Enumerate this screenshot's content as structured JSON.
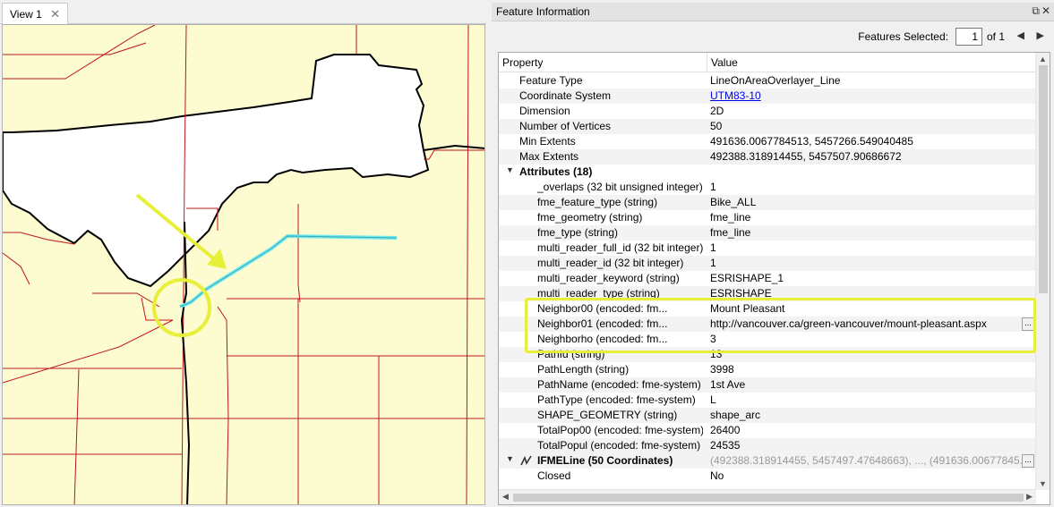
{
  "view": {
    "tab_label": "View 1",
    "tab_close": "✕"
  },
  "info": {
    "title": "Feature Information",
    "float_icon": "⧉",
    "close_icon": "✕",
    "features_selected_label": "Features Selected:",
    "selected_value": "1",
    "of_total": "of 1",
    "prev_icon": "◀",
    "next_icon": "▶"
  },
  "table": {
    "header_property": "Property",
    "header_value": "Value",
    "rows": [
      {
        "k": "Feature Type",
        "v": "LineOnAreaOverlayer_Line"
      },
      {
        "k": "Coordinate System",
        "v": "UTM83-10",
        "link": true
      },
      {
        "k": "Dimension",
        "v": "2D"
      },
      {
        "k": "Number of Vertices",
        "v": "50"
      },
      {
        "k": "Min Extents",
        "v": "491636.0067784513, 5457266.549040485"
      },
      {
        "k": "Max Extents",
        "v": "492388.318914455, 5457507.90686672"
      }
    ],
    "attributes_section": "Attributes (18)",
    "attributes": [
      {
        "k": "_overlaps (32 bit unsigned integer)",
        "v": "1"
      },
      {
        "k": "fme_feature_type (string)",
        "v": "Bike_ALL"
      },
      {
        "k": "fme_geometry (string)",
        "v": "fme_line"
      },
      {
        "k": "fme_type (string)",
        "v": "fme_line"
      },
      {
        "k": "multi_reader_full_id (32 bit integer)",
        "v": "1"
      },
      {
        "k": "multi_reader_id (32 bit integer)",
        "v": "1"
      },
      {
        "k": "multi_reader_keyword (string)",
        "v": "ESRISHAPE_1"
      },
      {
        "k": "multi_reader_type (string)",
        "v": "ESRISHAPE"
      },
      {
        "k": "Neighbor00 (encoded: fm...",
        "v": "Mount Pleasant"
      },
      {
        "k": "Neighbor01 (encoded: fm...",
        "v": "http://vancouver.ca/green-vancouver/mount-pleasant.aspx",
        "btn": "..."
      },
      {
        "k": "Neighborho (encoded: fm...",
        "v": "3"
      },
      {
        "k": "PathId (string)",
        "v": "13"
      },
      {
        "k": "PathLength (string)",
        "v": "3998"
      },
      {
        "k": "PathName (encoded: fme-system)",
        "v": "1st Ave"
      },
      {
        "k": "PathType (encoded: fme-system)",
        "v": "L"
      },
      {
        "k": "SHAPE_GEOMETRY (string)",
        "v": "shape_arc"
      },
      {
        "k": "TotalPop00 (encoded: fme-system)",
        "v": "26400"
      },
      {
        "k": "TotalPopul (encoded: fme-system)",
        "v": "24535"
      }
    ],
    "geometry_section": "IFMELine (50 Coordinates)",
    "geometry_value": "(492388.318914455, 5457497.47648663), ..., (491636.00677845...",
    "geometry_btn": "...",
    "closed_label": "Closed",
    "closed_value": "No"
  },
  "colors": {
    "map_background": "#fdfbd0",
    "road_lines": "#c0141c",
    "boundary": "#000000",
    "selected_line": "#6fe8ef",
    "annotation": "#e8ef38"
  },
  "icons": {
    "expand": "▼",
    "scroll_up": "▲",
    "scroll_down": "▼",
    "scroll_left": "◀",
    "scroll_right": "▶"
  }
}
